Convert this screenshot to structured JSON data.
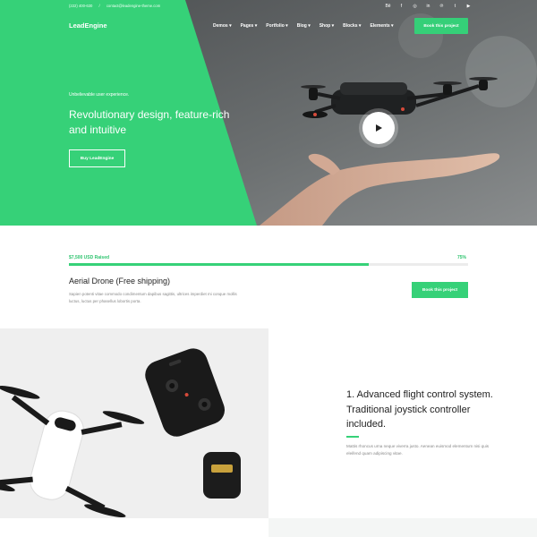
{
  "topbar": {
    "phone": "(222) 400-630",
    "email": "contact@leadengine-theme.com",
    "socials": [
      "behance-icon",
      "facebook-icon",
      "instagram-icon",
      "linkedin-icon",
      "pinterest-icon",
      "twitter-icon",
      "youtube-icon"
    ],
    "social_glyphs": [
      "Bē",
      "f",
      "◎",
      "in",
      "℗",
      "t",
      "▶"
    ]
  },
  "header": {
    "logo": "LeadEngine",
    "nav": [
      "Demos",
      "Pages",
      "Portfolio",
      "Blog",
      "Shop",
      "Blocks",
      "Elements"
    ],
    "cta": "Book this project"
  },
  "hero": {
    "eyebrow": "Unbelievable user experience.",
    "title": "Revolutionary design, feature-rich and intuitive",
    "button": "Buy LeadEngine"
  },
  "fundraise": {
    "raised_label": "$7,500 USD Raised",
    "percent_label": "75%",
    "progress": 0.75,
    "product_title": "Aerial Drone (Free shipping)",
    "product_desc": "Sapien potenti vitae commodo condimentum dapibus sagittis, ultrices imperdiet mi conque mollis luctus, luctus per phasellus lobortis porta.",
    "button": "Book this project"
  },
  "feature": {
    "title": "1. Advanced flight control system. Traditional joystick controller included.",
    "desc": "Mattis rhoncus urna neque viverra justo. Aenean euismod elementum nisi quis eleifend quam adipiscing vitae."
  },
  "colors": {
    "accent": "#36d178",
    "text": "#222222",
    "muted": "#888888"
  }
}
